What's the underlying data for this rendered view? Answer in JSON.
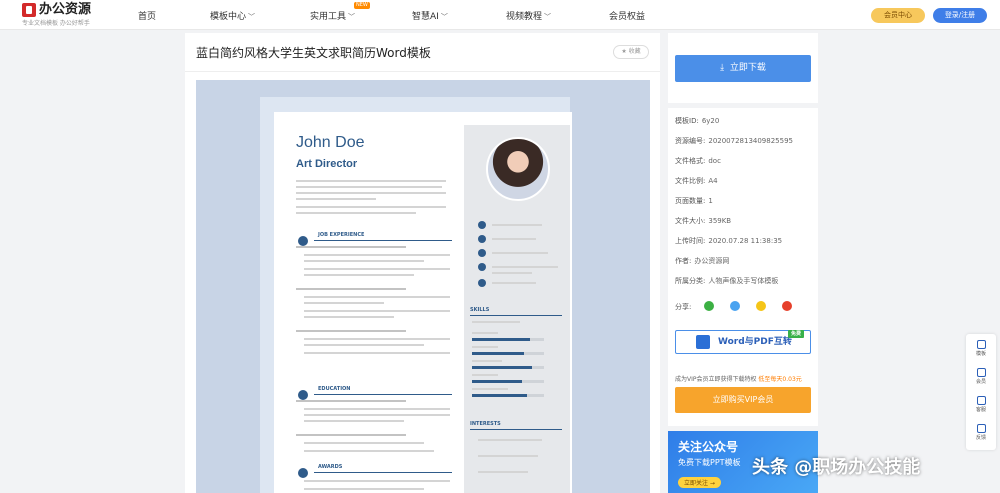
{
  "header": {
    "logo_text": "办公资源",
    "logo_sub": "专业文档模板 办公好帮手",
    "nav": [
      {
        "label": "首页"
      },
      {
        "label": "模板中心"
      },
      {
        "label": "实用工具"
      },
      {
        "label": "智慧AI"
      },
      {
        "label": "视频教程"
      },
      {
        "label": "会员权益"
      }
    ],
    "new_badge": "NEW",
    "vip_label": "会员中心",
    "login_label": "登录/注册"
  },
  "document": {
    "title": "蓝白简约风格大学生英文求职简历Word模板",
    "fav_label": "收藏"
  },
  "resume": {
    "name": "John Doe",
    "role": "Art Director",
    "sections": {
      "experience": "JOB EXPERIENCE",
      "education": "EDUCATION",
      "awards": "AWARDS",
      "skills": "SKILLS",
      "interests": "INTERESTS"
    }
  },
  "download": {
    "button_label": "立即下载"
  },
  "info": [
    {
      "label": "模板ID:",
      "value": "6y20"
    },
    {
      "label": "资源编号:",
      "value": "2020072813409825595"
    },
    {
      "label": "文件格式:",
      "value": "doc"
    },
    {
      "label": "文件比例:",
      "value": "A4"
    },
    {
      "label": "页面数量:",
      "value": "1"
    },
    {
      "label": "文件大小:",
      "value": "359KB"
    },
    {
      "label": "上传时间:",
      "value": "2020.07.28 11:38:35"
    },
    {
      "label": "作者:",
      "value": "办公资源网"
    },
    {
      "label": "所属分类:",
      "value": "人物声像及手写体模板"
    }
  ],
  "share_label": "分享:",
  "promo": {
    "convert_label": "Word与PDF互转",
    "free_badge": "免费",
    "text_prefix": "成为VIP会员立即获得下载特权",
    "text_highlight": "低至每天0.03元",
    "vip_button": "立即购买VIP会员"
  },
  "banner": {
    "title": "关注公众号",
    "subtitle": "免费下载PPT模板",
    "button": "立即关注 →"
  },
  "float_tools": [
    {
      "label": "模板"
    },
    {
      "label": "会员"
    },
    {
      "label": "客服"
    },
    {
      "label": "反馈"
    }
  ],
  "watermark": "头条 @职场办公技能"
}
